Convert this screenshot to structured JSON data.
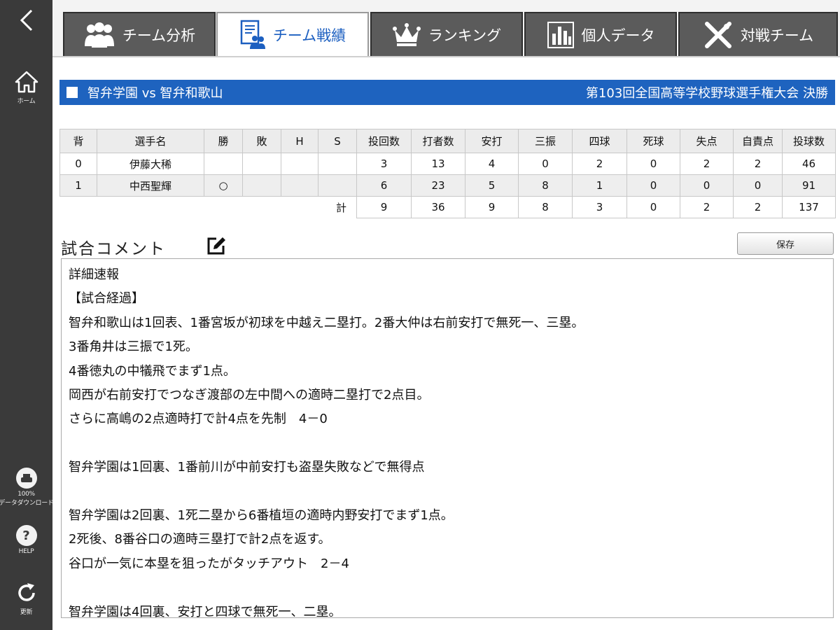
{
  "sidebar": {
    "back_icon": "chevron-left-icon",
    "home_label": "ホーム",
    "download_label": "データダウンロード",
    "download_percent": "100%",
    "help_label": "HELP",
    "refresh_label": "更新"
  },
  "tabs": [
    {
      "label": "チーム分析",
      "icon": "team-people-icon",
      "active": false
    },
    {
      "label": "チーム戦績",
      "icon": "scoresheet-icon",
      "active": true
    },
    {
      "label": "ランキング",
      "icon": "crown-icon",
      "active": false
    },
    {
      "label": "個人データ",
      "icon": "bar-chart-icon",
      "active": false
    },
    {
      "label": "対戦チーム",
      "icon": "crossed-bats-icon",
      "active": false
    }
  ],
  "banner": {
    "matchup": "智弁学園 vs 智弁和歌山",
    "tournament": "第103回全国高等学校野球選手権大会 決勝"
  },
  "stats": {
    "headers": [
      "背",
      "選手名",
      "勝",
      "敗",
      "H",
      "S",
      "投回数",
      "打者数",
      "安打",
      "三振",
      "四球",
      "死球",
      "失点",
      "自責点",
      "投球数"
    ],
    "rows": [
      [
        "0",
        "伊藤大稀",
        "",
        "",
        "",
        "",
        "3",
        "13",
        "4",
        "0",
        "2",
        "0",
        "2",
        "2",
        "46"
      ],
      [
        "1",
        "中西聖輝",
        "○",
        "",
        "",
        "",
        "6",
        "23",
        "5",
        "8",
        "1",
        "0",
        "0",
        "0",
        "91"
      ]
    ],
    "total_label": "計",
    "totals": [
      "9",
      "36",
      "9",
      "8",
      "3",
      "0",
      "2",
      "2",
      "137"
    ]
  },
  "comment": {
    "title": "試合コメント",
    "save_label": "保存",
    "text": "詳細速報\n【試合経過】\n智弁和歌山は1回表、1番宮坂が初球を中越え二塁打。2番大仲は右前安打で無死一、三塁。\n3番角井は三振で1死。\n4番徳丸の中犠飛でまず1点。\n岡西が右前安打でつなぎ渡部の左中間への適時二塁打で2点目。\nさらに高嶋の2点適時打で計4点を先制　4－0\n\n智弁学園は1回裏、1番前川が中前安打も盗塁失敗などで無得点\n\n智弁学園は2回裏、1死二塁から6番植垣の適時内野安打でまず1点。\n2死後、8番谷口の適時三塁打で計2点を返す。\n谷口が一気に本塁を狙ったがタッチアウト　2－4\n\n智弁学園は4回裏、安打と四球で無死一、二塁。"
  }
}
